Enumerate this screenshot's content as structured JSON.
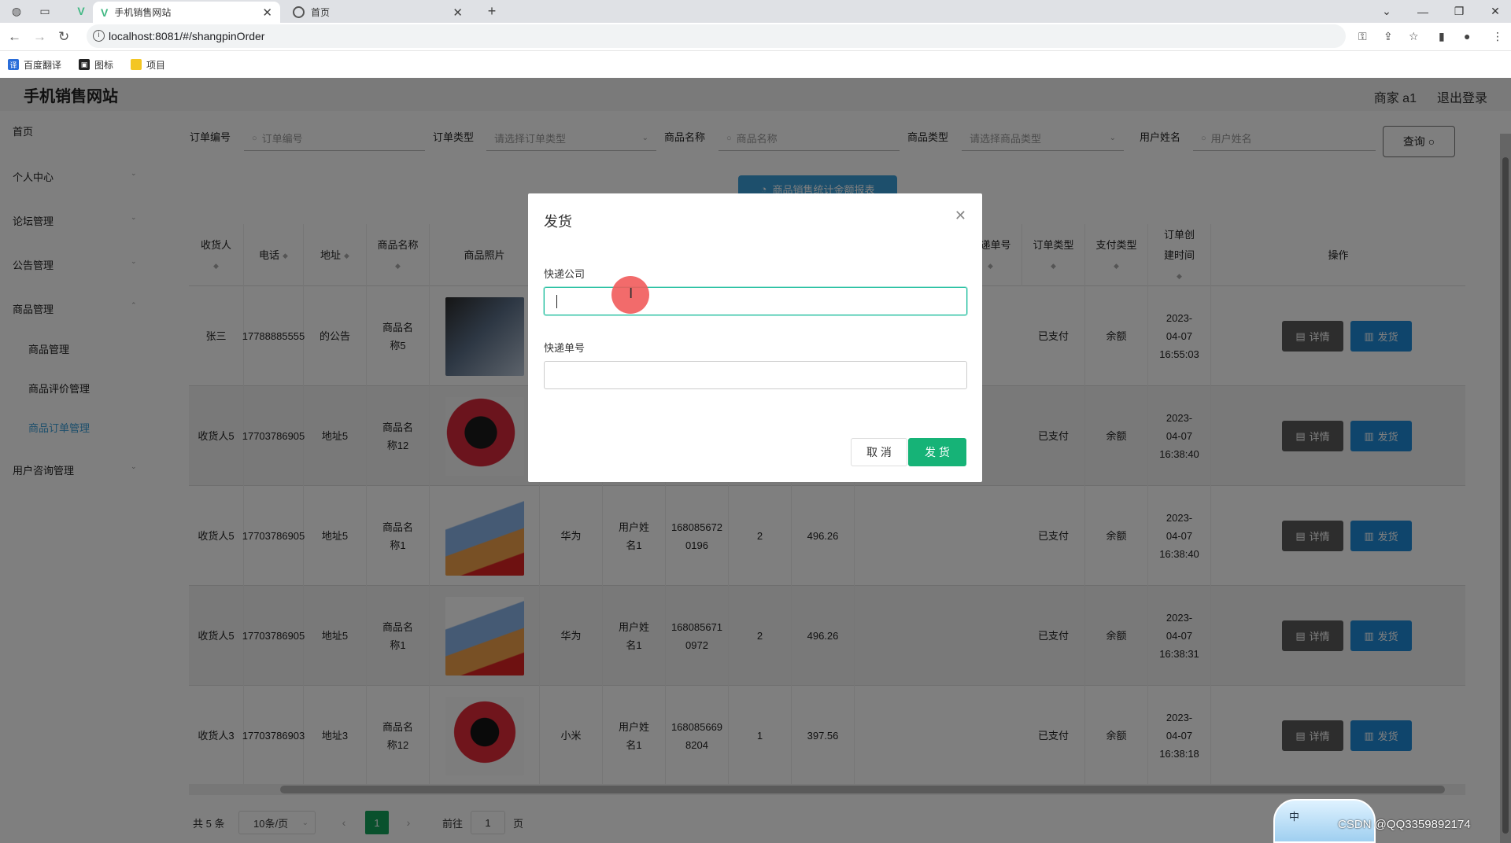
{
  "browser": {
    "tabs": [
      {
        "title": "手机销售网站",
        "active": true
      },
      {
        "title": "首页",
        "active": false
      }
    ],
    "url": "localhost:8081/#/shangpinOrder",
    "bookmarks": [
      "百度翻译",
      "图标",
      "项目"
    ]
  },
  "app": {
    "brand": "手机销售网站",
    "user": "商家 a1",
    "logout": "退出登录"
  },
  "sidebar": {
    "items": [
      {
        "label": "首页"
      },
      {
        "label": "个人中心"
      },
      {
        "label": "论坛管理"
      },
      {
        "label": "公告管理"
      },
      {
        "label": "商品管理"
      },
      {
        "label": "商品管理"
      },
      {
        "label": "商品评价管理"
      },
      {
        "label": "商品订单管理"
      },
      {
        "label": "用户咨询管理"
      }
    ]
  },
  "search": {
    "order_no_label": "订单编号",
    "order_no_ph": "订单编号",
    "order_type_label": "订单类型",
    "order_type_ph": "请选择订单类型",
    "product_name_label": "商品名称",
    "product_name_ph": "商品名称",
    "product_type_label": "商品类型",
    "product_type_ph": "请选择商品类型",
    "user_name_label": "用户姓名",
    "user_name_ph": "用户姓名",
    "query_btn": "查询",
    "stats_btn": "商品销售统计金额报表"
  },
  "table": {
    "headers": [
      "收货人",
      "电话",
      "地址",
      "商品名称",
      "商品照片",
      "快递单号",
      "订单类型",
      "支付类型",
      "订单创建时间",
      "操作"
    ],
    "detail_btn": "详情",
    "ship_btn": "发货",
    "rows": [
      {
        "receiver": "张三",
        "phone": "17788885555",
        "address": "的公告",
        "product": "商品名称5",
        "type": "",
        "user": "",
        "order_no": "",
        "qty": "",
        "amount": "",
        "order_type": "已支付",
        "pay_type": "余额",
        "time": "2023-04-07 16:55:03"
      },
      {
        "receiver": "收货人5",
        "phone": "17703786905",
        "address": "地址5",
        "product": "商品名称12",
        "type": "",
        "user": "",
        "order_no": "",
        "qty": "",
        "amount": "",
        "order_type": "已支付",
        "pay_type": "余额",
        "time": "2023-04-07 16:38:40"
      },
      {
        "receiver": "收货人5",
        "phone": "17703786905",
        "address": "地址5",
        "product": "商品名称1",
        "type": "华为",
        "user": "用户姓名1",
        "order_no": "1680856720196",
        "qty": "2",
        "amount": "496.26",
        "order_type": "已支付",
        "pay_type": "余额",
        "time": "2023-04-07 16:38:40"
      },
      {
        "receiver": "收货人5",
        "phone": "17703786905",
        "address": "地址5",
        "product": "商品名称1",
        "type": "华为",
        "user": "用户姓名1",
        "order_no": "1680856710972",
        "qty": "2",
        "amount": "496.26",
        "order_type": "已支付",
        "pay_type": "余额",
        "time": "2023-04-07 16:38:31"
      },
      {
        "receiver": "收货人3",
        "phone": "17703786903",
        "address": "地址3",
        "product": "商品名称12",
        "type": "小米",
        "user": "用户姓名1",
        "order_no": "1680856698204",
        "qty": "1",
        "amount": "397.56",
        "order_type": "已支付",
        "pay_type": "余额",
        "time": "2023-04-07 16:38:18"
      }
    ]
  },
  "pagination": {
    "total": "共 5 条",
    "page_size": "10条/页",
    "current": "1",
    "goto_prefix": "前往",
    "goto_value": "1",
    "goto_suffix": "页"
  },
  "dialog": {
    "title": "发货",
    "company_label": "快递公司",
    "company_value": "",
    "number_label": "快递单号",
    "number_value": "",
    "cancel": "取 消",
    "confirm": "发 货"
  },
  "ime_label": "中",
  "watermark": "CSDN @QQ3359892174",
  "colors": {
    "accent": "#16b377",
    "ship": "#1e8bd8",
    "detail": "#5b5b5b",
    "cursor": "#f15b5b"
  }
}
